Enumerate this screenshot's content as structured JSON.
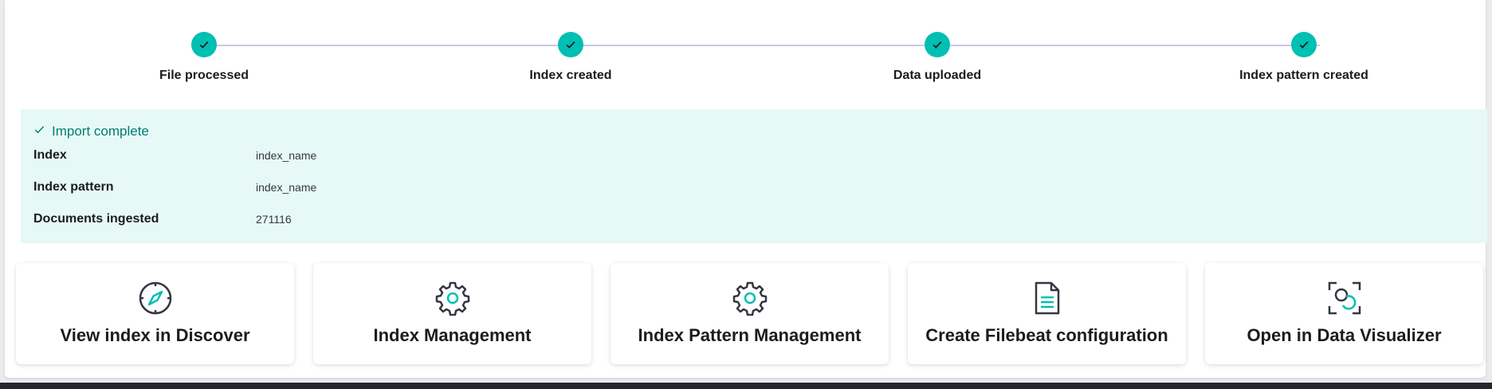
{
  "steps": [
    {
      "label": "File processed"
    },
    {
      "label": "Index created"
    },
    {
      "label": "Data uploaded"
    },
    {
      "label": "Index pattern created"
    }
  ],
  "callout": {
    "title": "Import complete",
    "rows": [
      {
        "key": "Index",
        "value": "index_name"
      },
      {
        "key": "Index pattern",
        "value": "index_name"
      },
      {
        "key": "Documents ingested",
        "value": "271116"
      }
    ]
  },
  "cards": [
    {
      "title": "View index in Discover",
      "icon": "compass-icon"
    },
    {
      "title": "Index Management",
      "icon": "gear-icon"
    },
    {
      "title": "Index Pattern Management",
      "icon": "gear-icon"
    },
    {
      "title": "Create Filebeat configuration",
      "icon": "document-icon"
    },
    {
      "title": "Open in Data Visualizer",
      "icon": "data-visualizer-icon"
    }
  ],
  "colors": {
    "accent": "#00bfb3",
    "success_text": "#017d73",
    "callout_bg": "#e6f9f7",
    "step_line": "#c5cae8"
  }
}
